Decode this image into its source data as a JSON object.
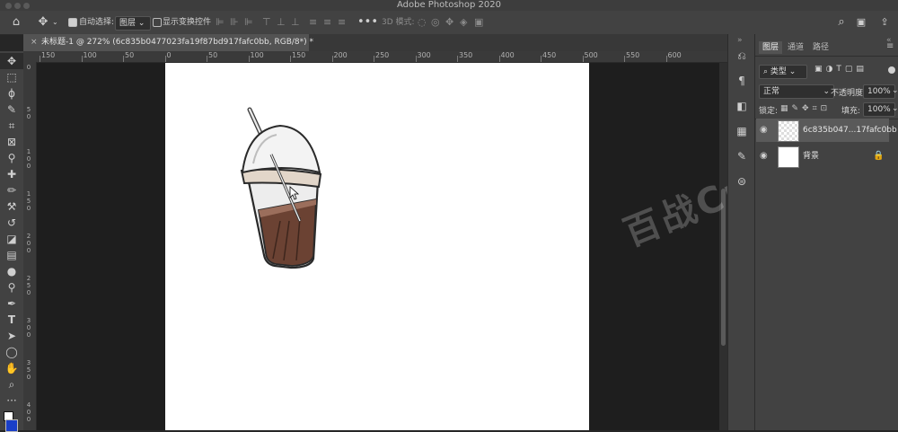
{
  "window": {
    "title": "Adobe Photoshop 2020"
  },
  "options_bar": {
    "auto_select_label": "自动选择:",
    "auto_select_value": "图层",
    "show_transform_label": "显示变换控件",
    "mode_3d_label": "3D 模式:"
  },
  "document": {
    "tab_title": "未标题-1 @ 272% (6c835b0477023fa19f87bd917fafc0bb, RGB/8*) *",
    "close_glyph": "×"
  },
  "rulers": {
    "h_labels": [
      "150",
      "100",
      "50",
      "0",
      "50",
      "100",
      "150",
      "200",
      "250",
      "300",
      "350",
      "400",
      "450",
      "500",
      "550",
      "600"
    ],
    "v_labels": [
      "0",
      "5 0",
      "1 0 0",
      "1 5 0",
      "2 0 0",
      "2 5 0",
      "3 0 0",
      "3 5 0",
      "4 0 0"
    ]
  },
  "panels": {
    "tabs": [
      "图层",
      "通道",
      "路径"
    ],
    "filter_label": "类型",
    "blend_mode": "正常",
    "opacity_label": "不透明度:",
    "opacity_value": "100%",
    "lock_label": "锁定:",
    "fill_label": "填充:",
    "fill_value": "100%",
    "layers": [
      {
        "name": "6c835b047...17fafc0bb",
        "selected": true
      },
      {
        "name": "背景",
        "selected": false
      }
    ]
  },
  "watermark": {
    "text": "百战Cmin"
  },
  "colors": {
    "accent": "#2a62d8",
    "canvas": "#ffffff",
    "workspace": "#1e1e1e"
  }
}
